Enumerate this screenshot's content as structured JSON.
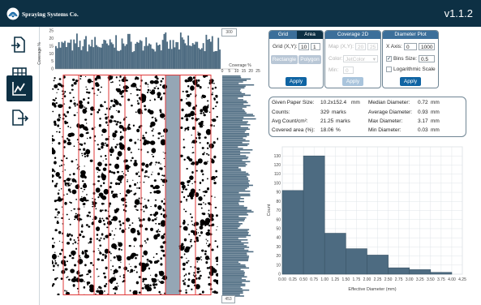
{
  "app": {
    "brand": "Spraying Systems Co.",
    "version": "v1.1.2"
  },
  "sidebar": {
    "items": [
      {
        "icon": "import-icon"
      },
      {
        "icon": "grid-icon"
      },
      {
        "icon": "chart-icon",
        "active": true
      },
      {
        "icon": "export-icon"
      }
    ]
  },
  "coverage_top": {
    "y_label": "Coverage %",
    "y_ticks": [
      "25",
      "20",
      "15",
      "10",
      "5",
      "0"
    ],
    "box_value": "300"
  },
  "coverage_side": {
    "label": "Coverage %",
    "x_ticks": [
      "0",
      "5",
      "10",
      "15",
      "20",
      "25"
    ],
    "box_value": "453"
  },
  "panels": {
    "grid_area": {
      "tab_grid": "Grid",
      "tab_area": "Area",
      "grid_xy_label": "Grid (X,Y):",
      "grid_x": "10",
      "grid_y": "1",
      "btn_rectangle": "Rectangle",
      "btn_polygon": "Polygon",
      "apply": "Apply"
    },
    "coverage2d": {
      "tab": "Coverage 2D",
      "map_xy_label": "Map (X,Y):",
      "map_x": "20",
      "map_y": "25",
      "color_label": "Color:",
      "color_value": "JetColor",
      "min_label": "Min:",
      "min_value": "0",
      "apply": "Apply"
    },
    "diameter": {
      "tab": "Diameter Plot",
      "xaxis_label": "X Axis:",
      "xaxis_min": "0",
      "xaxis_max": "1000",
      "bins_label": "Bins Size:",
      "bins_value": "0.5",
      "log_label": "Logarithmic Scale",
      "bins_checked": true,
      "log_checked": false,
      "apply": "Apply"
    }
  },
  "stats": {
    "paper_size_label": "Given Paper Size:",
    "paper_size_value": "10.2x152.4",
    "paper_size_unit": "mm",
    "counts_label": "Counts:",
    "counts_value": "329",
    "counts_unit": "marks",
    "avg_count_label": "Avg Count/cm²:",
    "avg_count_value": "21.25",
    "avg_count_unit": "marks",
    "covered_label": "Covered area (%):",
    "covered_value": "18.06",
    "covered_unit": "%",
    "median_label": "Median Diameter:",
    "median_value": "0.72",
    "median_unit": "mm",
    "average_label": "Average Diameter:",
    "average_value": "0.93",
    "average_unit": "mm",
    "max_label": "Max Diameter:",
    "max_value": "3.17",
    "max_unit": "mm",
    "min_label": "Min Diameter:",
    "min_value": "0.03",
    "min_unit": "mm"
  },
  "chart_data": {
    "type": "bar",
    "xlabel": "Effective Diameter (mm)",
    "ylabel": "Count",
    "ylim": [
      0,
      140
    ],
    "xlim": [
      0,
      4.25
    ],
    "grid": true,
    "bin_edges": [
      0,
      0.5,
      1.0,
      1.5,
      2.0,
      2.5,
      3.0,
      3.5,
      4.0
    ],
    "values": [
      92,
      130,
      45,
      28,
      21,
      7,
      5,
      2
    ],
    "x_ticks": [
      "0.00",
      "0.25",
      "0.50",
      "0.75",
      "1.00",
      "1.25",
      "1.50",
      "1.75",
      "2.00",
      "2.25",
      "2.50",
      "2.75",
      "3.00",
      "3.25",
      "3.50",
      "3.75",
      "4.00",
      "4.25"
    ],
    "y_ticks": [
      "0",
      "10",
      "20",
      "30",
      "40",
      "50",
      "60",
      "70",
      "80",
      "90",
      "100",
      "110",
      "120",
      "130"
    ],
    "colors": {
      "bar": "#4d6b81",
      "bar_edge": "#3a5466",
      "grid": "#dfe4e8"
    }
  },
  "colors": {
    "titlebar": "#0d3044",
    "accent": "#0f64a3",
    "grid_line": "#e03a3a",
    "selected_strip": "#95a6b5",
    "coverage_fill": "#4d6b81"
  }
}
